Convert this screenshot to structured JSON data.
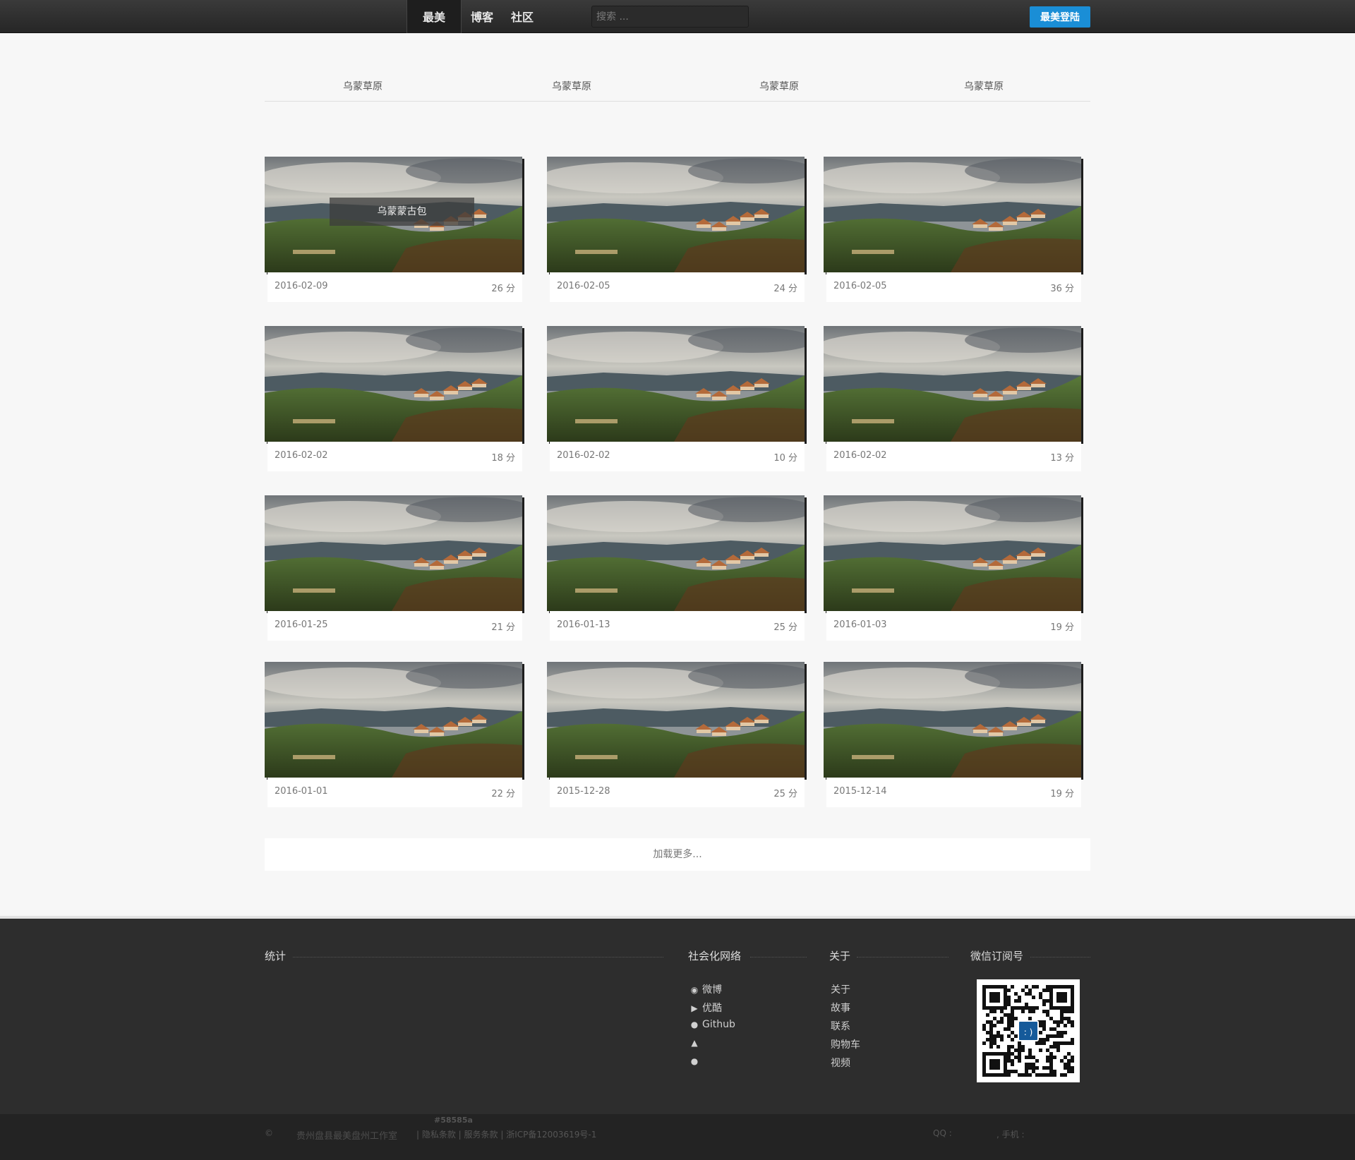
{
  "nav": {
    "items": [
      "最美",
      "博客",
      "社区"
    ],
    "search_placeholder": "搜索 ...",
    "login": "最美登陆"
  },
  "categories": [
    "乌蒙草原",
    "乌蒙草原",
    "乌蒙草原",
    "乌蒙草原"
  ],
  "cards": [
    {
      "date": "2016-02-09",
      "score": "26 分",
      "overlay": "乌蒙蒙古包"
    },
    {
      "date": "2016-02-05",
      "score": "24 分"
    },
    {
      "date": "2016-02-05",
      "score": "36 分"
    },
    {
      "date": "2016-02-02",
      "score": "18 分"
    },
    {
      "date": "2016-02-02",
      "score": "10 分"
    },
    {
      "date": "2016-02-02",
      "score": "13 分"
    },
    {
      "date": "2016-01-25",
      "score": "21 分"
    },
    {
      "date": "2016-01-13",
      "score": "25 分"
    },
    {
      "date": "2016-01-03",
      "score": "19 分"
    },
    {
      "date": "2016-01-01",
      "score": "22 分"
    },
    {
      "date": "2015-12-28",
      "score": "25 分"
    },
    {
      "date": "2015-12-14",
      "score": "19 分"
    }
  ],
  "load_more": "加载更多...",
  "footer": {
    "stats_heading": "统计",
    "social_heading": "社会化网络",
    "social": [
      {
        "icon": "weibo-icon",
        "label": "微博"
      },
      {
        "icon": "youku-icon",
        "label": "优酷"
      },
      {
        "icon": "github-icon",
        "label": "Github"
      },
      {
        "icon": "qq-icon",
        "label": ""
      },
      {
        "icon": "wechat-icon",
        "label": ""
      }
    ],
    "about_heading": "关于",
    "about": [
      "关于",
      "故事",
      "联系",
      "购物车",
      "视频"
    ],
    "wechat_heading": "微信订阅号",
    "qr_center": ": )"
  },
  "bottom": {
    "copyright": "©",
    "studio": "贵州盘县最美盘州工作室",
    "color_note": "#58585a",
    "links": "| 隐私条款 | 服务条款 | 浙ICP备12003619号-1",
    "qq": "QQ :",
    "phone": ", 手机 :"
  }
}
